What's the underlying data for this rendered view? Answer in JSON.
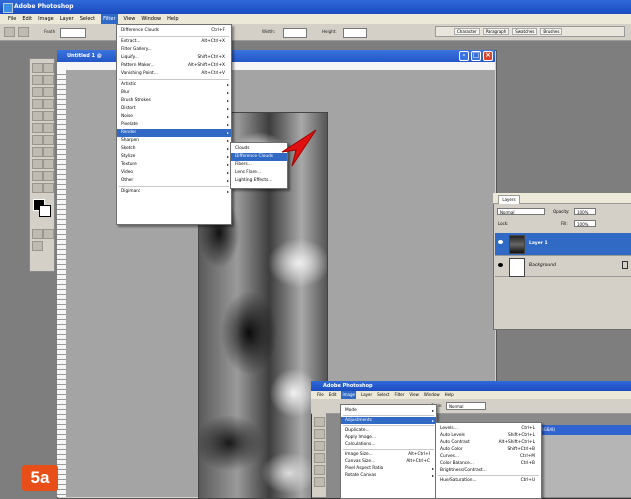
{
  "app": {
    "title": "Adobe Photoshop"
  },
  "menubar": [
    "File",
    "Edit",
    "Image",
    "Layer",
    "Select",
    "Filter",
    "View",
    "Window",
    "Help"
  ],
  "menubar_active": "Filter",
  "options_bar": {
    "width_label": "Width:",
    "height_label": "Height:",
    "feather_label": "Feath"
  },
  "palette_well": [
    "Character",
    "Paragraph",
    "Swatches",
    "Brushes"
  ],
  "canvas": {
    "title": "Untitled 1 @"
  },
  "filter_menu": {
    "items": [
      {
        "label": "Difference Clouds",
        "shortcut": "Ctrl+F"
      },
      {
        "sep": true
      },
      {
        "label": "Extract...",
        "shortcut": "Alt+Ctrl+X"
      },
      {
        "label": "Filter Gallery..."
      },
      {
        "label": "Liquify...",
        "shortcut": "Shift+Ctrl+X"
      },
      {
        "label": "Pattern Maker...",
        "shortcut": "Alt+Shift+Ctrl+X"
      },
      {
        "label": "Vanishing Point...",
        "shortcut": "Alt+Ctrl+V"
      },
      {
        "sep": true
      },
      {
        "label": "Artistic",
        "submenu": true
      },
      {
        "label": "Blur",
        "submenu": true
      },
      {
        "label": "Brush Strokes",
        "submenu": true
      },
      {
        "label": "Distort",
        "submenu": true
      },
      {
        "label": "Noise",
        "submenu": true
      },
      {
        "label": "Pixelate",
        "submenu": true
      },
      {
        "label": "Render",
        "submenu": true,
        "highlighted": true
      },
      {
        "label": "Sharpen",
        "submenu": true
      },
      {
        "label": "Sketch",
        "submenu": true
      },
      {
        "label": "Stylize",
        "submenu": true
      },
      {
        "label": "Texture",
        "submenu": true
      },
      {
        "label": "Video",
        "submenu": true
      },
      {
        "label": "Other",
        "submenu": true
      },
      {
        "sep": true
      },
      {
        "label": "Digimarc",
        "submenu": true
      }
    ]
  },
  "render_submenu": {
    "items": [
      {
        "label": "Clouds"
      },
      {
        "label": "Difference Clouds",
        "highlighted": true
      },
      {
        "label": "Fibers..."
      },
      {
        "label": "Lens Flare..."
      },
      {
        "label": "Lighting Effects..."
      }
    ]
  },
  "layers_panel": {
    "tab": "Layers",
    "blend_mode": "Normal",
    "opacity_label": "Opacity:",
    "opacity_value": "100%",
    "lock_label": "Lock:",
    "fill_label": "Fill:",
    "fill_value": "100%",
    "layers": [
      {
        "name": "Layer 1",
        "selected": true
      },
      {
        "name": "Background",
        "selected": false
      }
    ]
  },
  "inset": {
    "title": "Adobe Photoshop",
    "menubar": [
      "File",
      "Edit",
      "Image",
      "Layer",
      "Select",
      "Filter",
      "View",
      "Window",
      "Help"
    ],
    "menubar_active": "Image",
    "style_label": "Style:",
    "style_value": "Normal",
    "canvas_title": "RGB/8)",
    "image_menu": {
      "items": [
        {
          "label": "Mode",
          "submenu": true
        },
        {
          "sep": true
        },
        {
          "label": "Adjustments",
          "submenu": true,
          "highlighted": true
        },
        {
          "sep": true
        },
        {
          "label": "Duplicate..."
        },
        {
          "label": "Apply Image..."
        },
        {
          "label": "Calculations..."
        },
        {
          "sep": true
        },
        {
          "label": "Image Size...",
          "shortcut": "Alt+Ctrl+I"
        },
        {
          "label": "Canvas Size...",
          "shortcut": "Alt+Ctrl+C"
        },
        {
          "label": "Pixel Aspect Ratio",
          "submenu": true
        },
        {
          "label": "Rotate Canvas",
          "submenu": true
        }
      ]
    },
    "adjustments_submenu": {
      "items": [
        {
          "label": "Levels...",
          "shortcut": "Ctrl+L"
        },
        {
          "label": "Auto Levels",
          "shortcut": "Shift+Ctrl+L"
        },
        {
          "label": "Auto Contrast",
          "shortcut": "Alt+Shift+Ctrl+L"
        },
        {
          "label": "Auto Color",
          "shortcut": "Shift+Ctrl+B"
        },
        {
          "label": "Curves...",
          "shortcut": "Ctrl+M"
        },
        {
          "label": "Color Balance...",
          "shortcut": "Ctrl+B"
        },
        {
          "label": "Brightness/Contrast..."
        },
        {
          "sep": true
        },
        {
          "label": "Hue/Saturation...",
          "shortcut": "Ctrl+U"
        }
      ]
    }
  },
  "step_label": "5a",
  "colors": {
    "highlight": "#316ac5",
    "title_blue": "#2f6ad9",
    "step_badge": "#e84e17",
    "pointer_arrow": "#e01010"
  }
}
